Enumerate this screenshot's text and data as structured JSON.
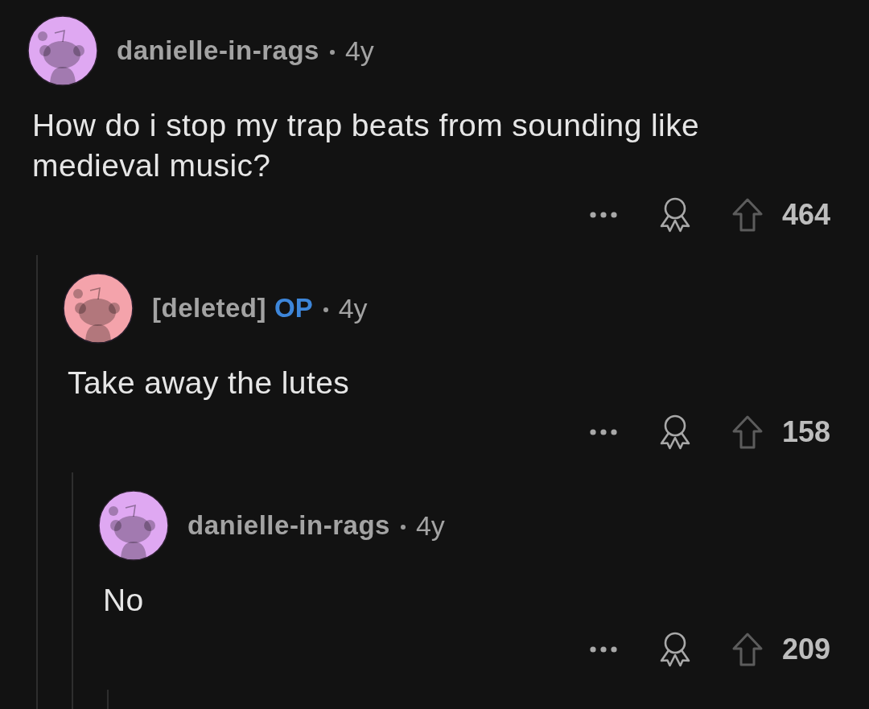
{
  "comments": [
    {
      "author": "danielle-in-rags",
      "age": "4y",
      "color": "#dfa8f2",
      "body": "How do i stop my trap beats from sounding like medieval music?",
      "votes": "464",
      "children": [
        {
          "author": "[deleted]",
          "author_tag": "OP",
          "age": "4y",
          "color": "#f4a3ab",
          "body": "Take away the lutes",
          "votes": "158",
          "children": [
            {
              "author": "danielle-in-rags",
              "age": "4y",
              "color": "#dfa8f2",
              "body": "No",
              "votes": "209"
            }
          ]
        }
      ]
    }
  ]
}
